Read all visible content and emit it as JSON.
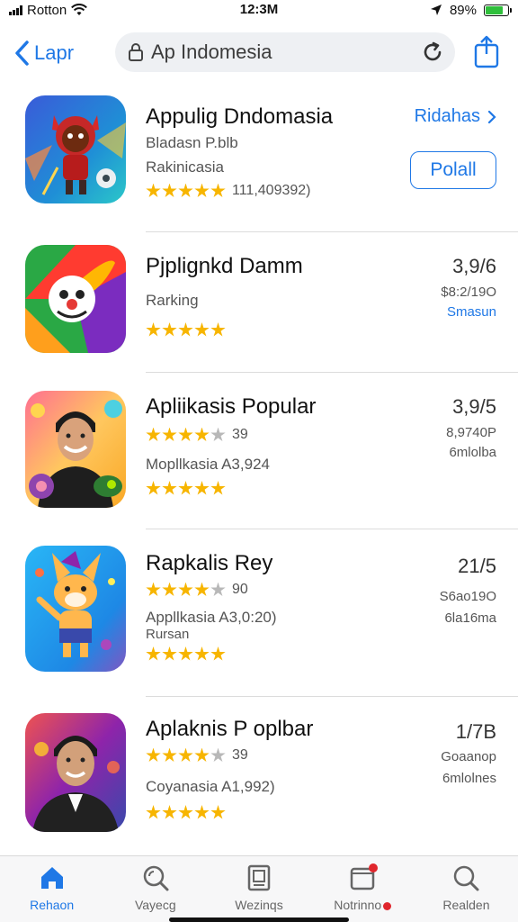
{
  "status": {
    "carrier": "Rotton",
    "time": "12:3M",
    "battery": "89%",
    "battery_level": 0.8
  },
  "nav": {
    "back_label": "Lapr",
    "search_text": "Ap Indomesia"
  },
  "apps": [
    {
      "title": "Appulig Dndomasia",
      "line1": "Bladasn P.blb",
      "line2": "Rakinicasia",
      "rating": 4.5,
      "rating_count": "111,409392)",
      "link_label": "Ridahas",
      "button_label": "Polall"
    },
    {
      "title": "Pjplignkd Damm",
      "line1": "Rarking",
      "rating": 5,
      "price": "3,9/6",
      "sub1": "$8:2/19O",
      "sub2": "Smasun"
    },
    {
      "title": "Apliikasis Popular",
      "rating": 4,
      "rating_count": "39",
      "line1": "Mopllkasia A3,924",
      "rating2": 5,
      "price": "3,9/5",
      "sub1": "8,9740P",
      "sub2": "6mlolba"
    },
    {
      "title": "Rapkalis Rey",
      "rating": 4,
      "rating_count": "90",
      "line1": "Appllkasia A3,0:20)",
      "line2": "Rursan",
      "rating2": 5,
      "price": "21/5",
      "sub1": "S6ao19O",
      "sub2": "6la16ma"
    },
    {
      "title": "Aplaknis P oplbar",
      "rating": 4,
      "rating_count": "39",
      "line1": "Coyanasia A1,992)",
      "rating2": 5,
      "price": "1/7B",
      "sub1": "Goaanop",
      "sub2": "6mlolnes"
    }
  ],
  "tabs": [
    {
      "label": "Rehaon",
      "icon": "home-icon",
      "active": true
    },
    {
      "label": "Vayecg",
      "icon": "search-glass-icon"
    },
    {
      "label": "Wezinqs",
      "icon": "book-icon"
    },
    {
      "label": "Notrinno",
      "icon": "notification-icon"
    },
    {
      "label": "Realden",
      "icon": "search-icon"
    }
  ],
  "colors": {
    "accent": "#1f78e6",
    "star": "#f7b500",
    "badge": "#e0262d"
  }
}
